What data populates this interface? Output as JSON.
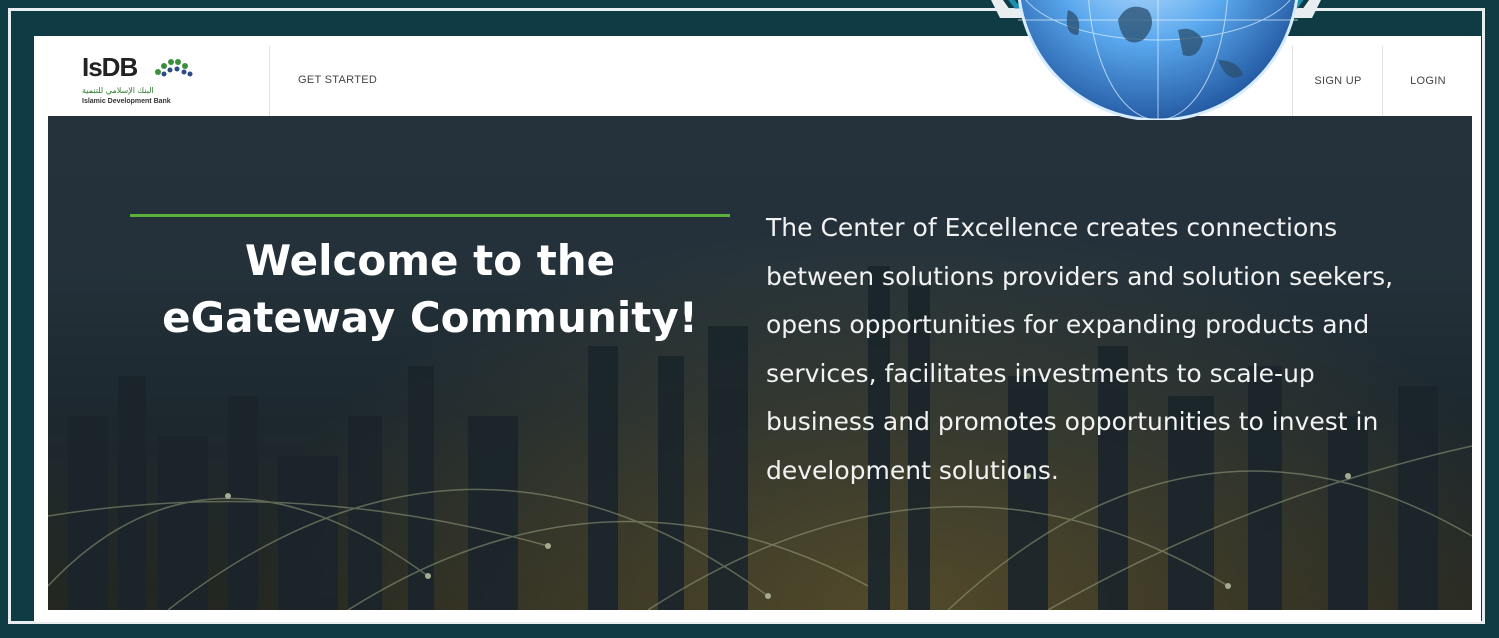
{
  "navbar": {
    "logo": {
      "name": "IsDB",
      "arabic": "البنك الإسلامي للتنمية",
      "subtitle": "Islamic Development Bank"
    },
    "get_started": "GET STARTED",
    "sign_up": "SIGN UP",
    "login": "LOGIN"
  },
  "hero": {
    "title": "Welcome to the eGateway Community!",
    "description": "The Center of Excellence creates connections between solutions providers and solution seekers, opens opportunities for expanding products and services, facilitates investments to scale-up business and promotes opportunities to invest in development solutions."
  },
  "colors": {
    "frame_bg": "#0f3b44",
    "accent_green": "#59b33a",
    "globe_blue": "#2f7fd0"
  },
  "icons": [
    "isdb-logo-icon",
    "globe-icon"
  ]
}
